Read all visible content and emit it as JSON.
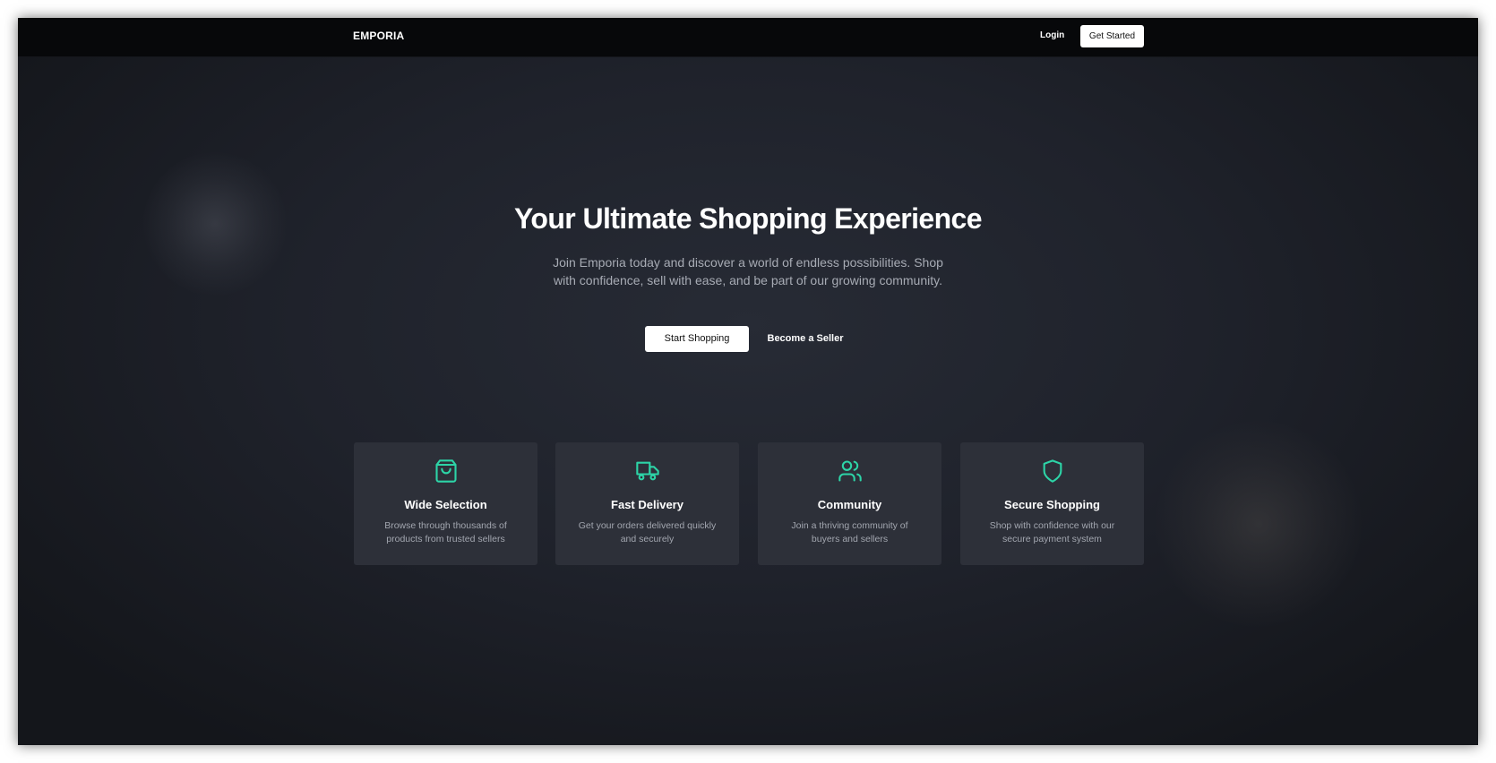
{
  "colors": {
    "accent": "#2dd4a7",
    "background": "#1f222b",
    "navbar": "#07080a",
    "card": "#2d3039"
  },
  "nav": {
    "logo": "EMPORIA",
    "login_label": "Login",
    "get_started_label": "Get Started"
  },
  "hero": {
    "title": "Your Ultimate Shopping Experience",
    "subtitle": "Join Emporia today and discover a world of endless possibilities. Shop with confidence, sell with ease, and be part of our growing community.",
    "primary_cta": "Start Shopping",
    "secondary_cta": "Become a Seller"
  },
  "features": [
    {
      "icon": "shopping-bag-icon",
      "title": "Wide Selection",
      "description": "Browse through thousands of products from trusted sellers"
    },
    {
      "icon": "truck-icon",
      "title": "Fast Delivery",
      "description": "Get your orders delivered quickly and securely"
    },
    {
      "icon": "users-icon",
      "title": "Community",
      "description": "Join a thriving community of buyers and sellers"
    },
    {
      "icon": "shield-icon",
      "title": "Secure Shopping",
      "description": "Shop with confidence with our secure payment system"
    }
  ]
}
